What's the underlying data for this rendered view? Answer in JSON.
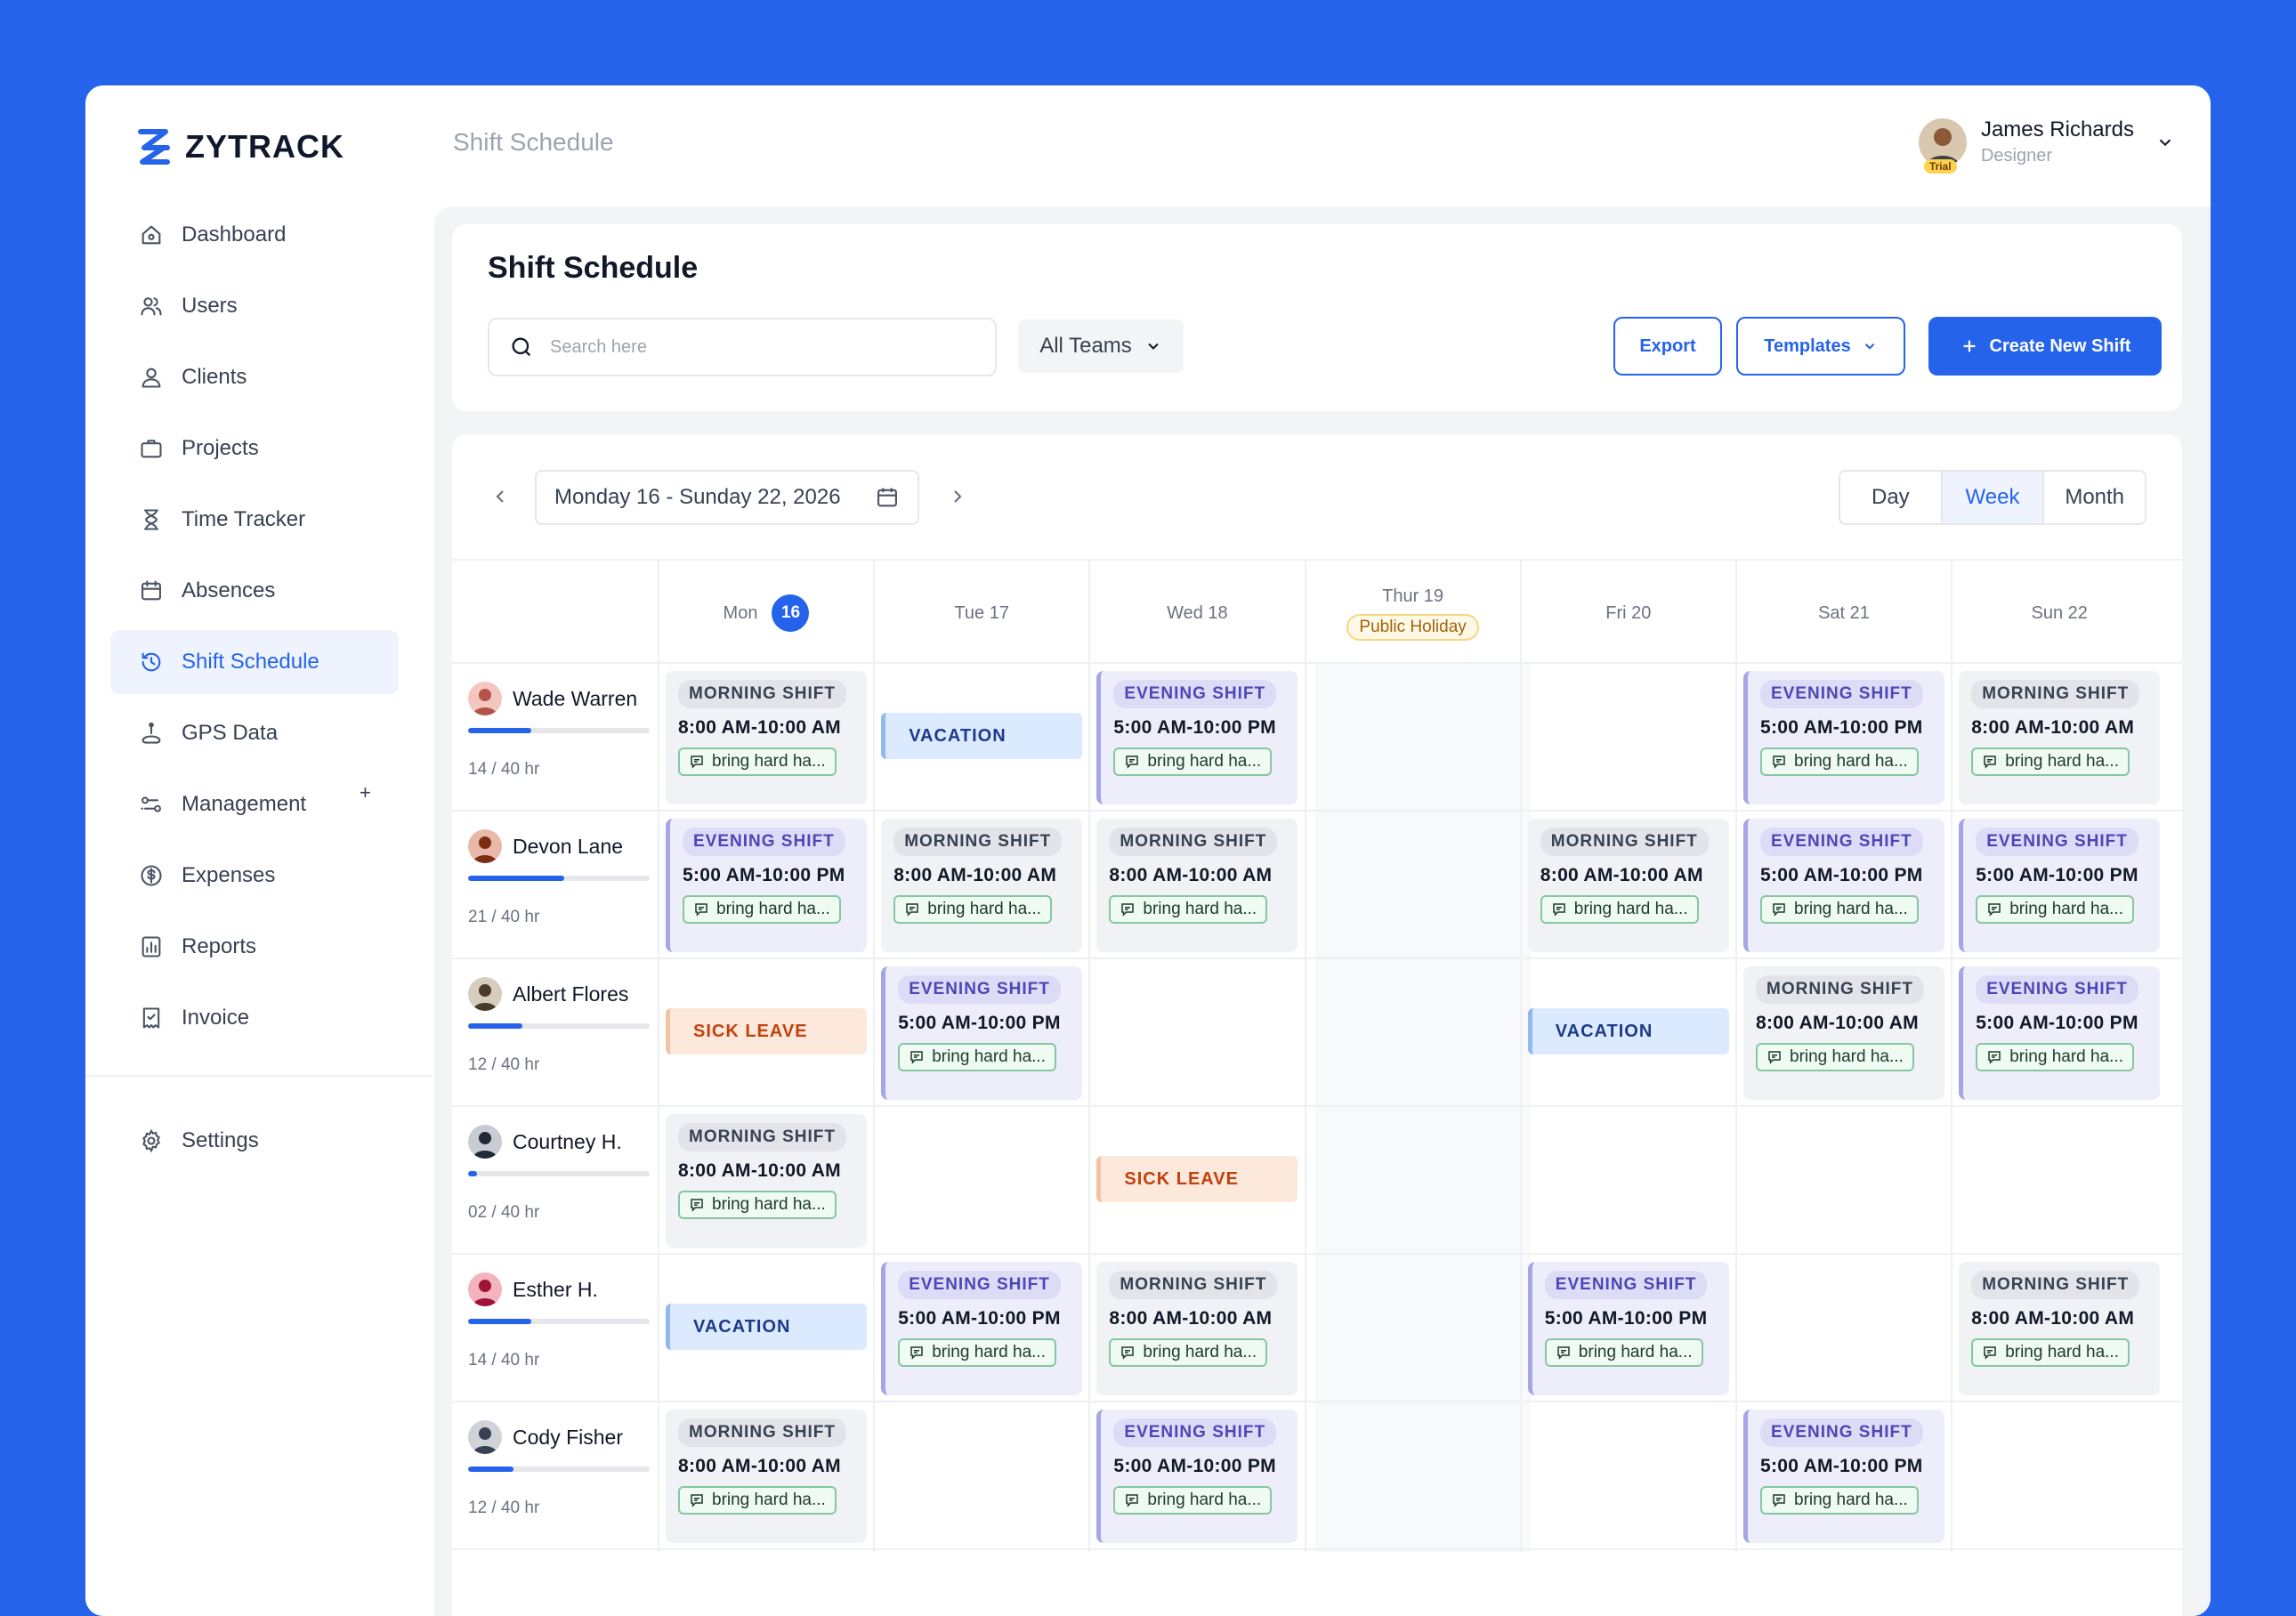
{
  "brand": {
    "name": "ZYTRACK",
    "color": "#2563eb"
  },
  "header": {
    "title": "Shift Schedule",
    "user": {
      "name": "James Richards",
      "role": "Designer",
      "badge": "Trial"
    }
  },
  "sidebar": {
    "items": [
      {
        "label": "Dashboard",
        "icon": "home-icon"
      },
      {
        "label": "Users",
        "icon": "users-icon"
      },
      {
        "label": "Clients",
        "icon": "user-icon"
      },
      {
        "label": "Projects",
        "icon": "briefcase-icon"
      },
      {
        "label": "Time Tracker",
        "icon": "hourglass-icon"
      },
      {
        "label": "Absences",
        "icon": "calendar-icon"
      },
      {
        "label": "Shift Schedule",
        "icon": "clock-refresh-icon",
        "active": true
      },
      {
        "label": "GPS Data",
        "icon": "gps-icon"
      },
      {
        "label": "Management",
        "icon": "route-icon",
        "extra": "+"
      },
      {
        "label": "Expenses",
        "icon": "dollar-icon"
      },
      {
        "label": "Reports",
        "icon": "report-icon"
      },
      {
        "label": "Invoice",
        "icon": "invoice-icon"
      }
    ],
    "settings": {
      "label": "Settings",
      "icon": "gear-icon"
    }
  },
  "toolbar": {
    "title": "Shift Schedule",
    "search_placeholder": "Search here",
    "teams": "All Teams",
    "export": "Export",
    "templates": "Templates",
    "create": "Create New Shift"
  },
  "schedule": {
    "date_range": "Monday 16 - Sunday 22, 2026",
    "views": [
      "Day",
      "Week",
      "Month"
    ],
    "active_view": "Week",
    "days": [
      {
        "label": "Mon",
        "num": "16",
        "today": true
      },
      {
        "label": "Tue 17"
      },
      {
        "label": "Wed 18"
      },
      {
        "label": "Thur 19",
        "holiday": "Public Holiday"
      },
      {
        "label": "Fri 20"
      },
      {
        "label": "Sat 21"
      },
      {
        "label": "Sun 22"
      }
    ],
    "people": [
      {
        "name": "Wade Warren",
        "hours": "14 / 40 hr",
        "progress": 0.35,
        "avatar_bg": "#f3c7c0",
        "avatar_fg": "#b45349",
        "shifts": [
          "M",
          "V",
          "E",
          null,
          null,
          "E",
          "M"
        ]
      },
      {
        "name": "Devon Lane",
        "hours": "21 / 40 hr",
        "progress": 0.525,
        "avatar_bg": "#e8b8a8",
        "avatar_fg": "#7c2d12",
        "shifts": [
          "E",
          "M",
          "M",
          null,
          "M",
          "E",
          "E"
        ]
      },
      {
        "name": "Albert Flores",
        "hours": "12 / 40 hr",
        "progress": 0.3,
        "avatar_bg": "#d6cdbf",
        "avatar_fg": "#4b3b2a",
        "shifts": [
          "S",
          "E",
          null,
          null,
          "V",
          "M",
          "E"
        ]
      },
      {
        "name": "Courtney H.",
        "hours": "02 / 40 hr",
        "progress": 0.05,
        "avatar_bg": "#c9ccd2",
        "avatar_fg": "#1f2937",
        "shifts": [
          "M",
          null,
          "S",
          null,
          null,
          null,
          null
        ]
      },
      {
        "name": "Esther H.",
        "hours": "14 / 40 hr",
        "progress": 0.35,
        "avatar_bg": "#f4b3bd",
        "avatar_fg": "#9f1239",
        "shifts": [
          "V",
          "E",
          "M",
          null,
          "E",
          null,
          "M"
        ]
      },
      {
        "name": "Cody Fisher",
        "hours": "12 / 40 hr",
        "progress": 0.25,
        "avatar_bg": "#cfd3d8",
        "avatar_fg": "#374151",
        "shifts": [
          "M",
          null,
          "E",
          null,
          null,
          "E",
          null
        ]
      }
    ]
  },
  "shift_types": {
    "M": {
      "kind": "morning",
      "label": "MORNING SHIFT",
      "time": "8:00 AM-10:00 AM",
      "note": "bring hard ha..."
    },
    "E": {
      "kind": "evening",
      "label": "EVENING SHIFT",
      "time": "5:00 AM-10:00 PM",
      "note": "bring hard ha..."
    },
    "V": {
      "kind": "vacation",
      "label": "VACATION"
    },
    "S": {
      "kind": "sick",
      "label": "SICK LEAVE"
    }
  }
}
